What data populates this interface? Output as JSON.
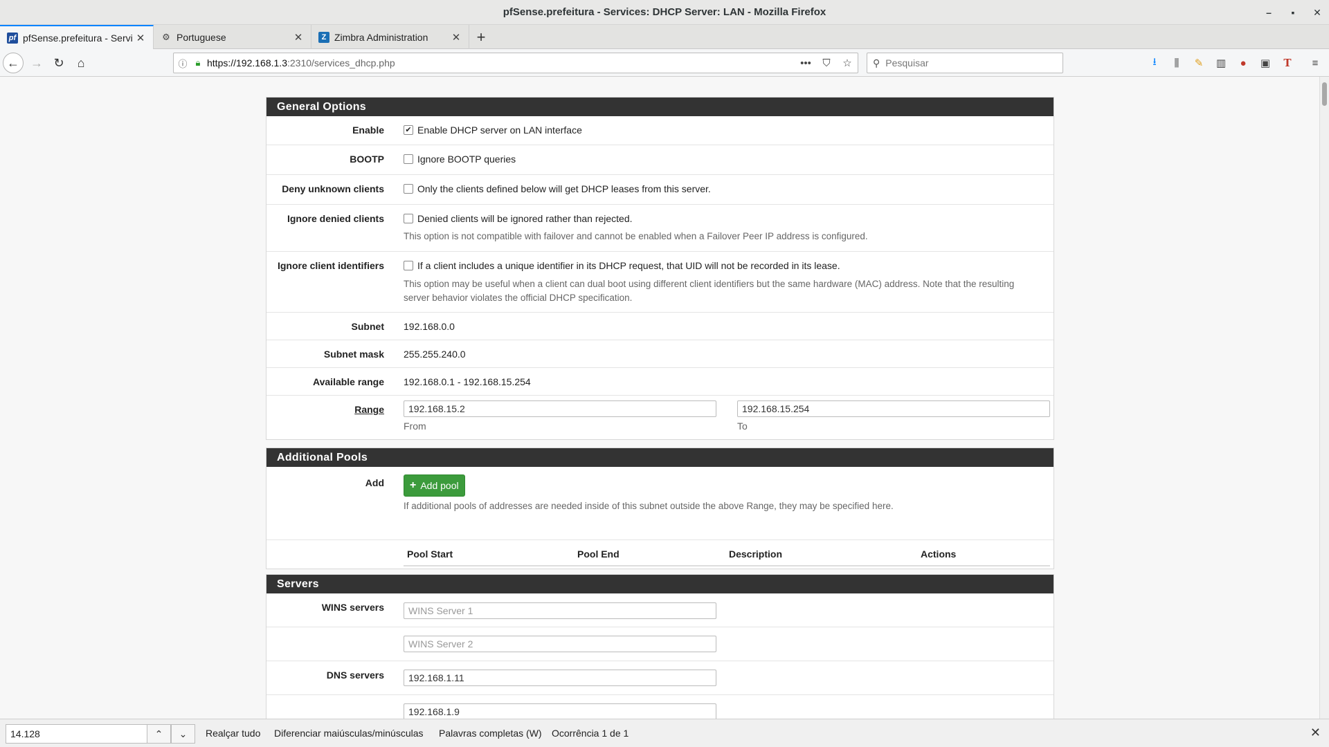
{
  "window": {
    "title": "pfSense.prefeitura - Services: DHCP Server: LAN - Mozilla Firefox",
    "min_glyph": "–",
    "max_glyph": "▪",
    "close_glyph": "✕"
  },
  "tabs": [
    {
      "label": "pfSense.prefeitura - Servi",
      "icon": "pfsense-favicon",
      "icon_text": "pf",
      "active": true
    },
    {
      "label": "Portuguese",
      "icon": "weblate-favicon",
      "icon_text": "⚙",
      "active": false
    },
    {
      "label": "Zimbra Administration",
      "icon": "zimbra-favicon",
      "icon_text": "Z",
      "active": false
    }
  ],
  "tab_close_glyph": "✕",
  "new_tab_glyph": "+",
  "nav": {
    "url_host": "https://192.168.1.3",
    "url_rest": ":2310/services_dhcp.php",
    "search_placeholder": "Pesquisar"
  },
  "general": {
    "heading": "General Options",
    "enable": {
      "label": "Enable",
      "text": "Enable DHCP server on LAN interface",
      "checked": true
    },
    "bootp": {
      "label": "BOOTP",
      "text": "Ignore BOOTP queries"
    },
    "deny": {
      "label": "Deny unknown clients",
      "text": "Only the clients defined below will get DHCP leases from this server."
    },
    "ignore_denied": {
      "label": "Ignore denied clients",
      "text": "Denied clients will be ignored rather than rejected.",
      "help": "This option is not compatible with failover and cannot be enabled when a Failover Peer IP address is configured."
    },
    "ignore_ids": {
      "label": "Ignore client identifiers",
      "text": "If a client includes a unique identifier in its DHCP request, that UID will not be recorded in its lease.",
      "help1": "This option may be useful when a client can dual boot using different client identifiers but the same hardware (MAC) address. Note that the resulting",
      "help2": "server behavior violates the official DHCP specification."
    },
    "subnet": {
      "label": "Subnet",
      "value": "192.168.0.0"
    },
    "mask": {
      "label": "Subnet mask",
      "value": "255.255.240.0"
    },
    "available": {
      "label": "Available range",
      "value": "192.168.0.1 - 192.168.15.254"
    },
    "range": {
      "label": "Range",
      "from": "192.168.15.2",
      "to": "192.168.15.254",
      "from_label": "From",
      "to_label": "To"
    }
  },
  "pools": {
    "heading": "Additional Pools",
    "add_label": "Add",
    "add_button": "Add pool",
    "help": "If additional pools of addresses are needed inside of this subnet outside the above Range, they may be specified here.",
    "columns": [
      "Pool Start",
      "Pool End",
      "Description",
      "Actions"
    ]
  },
  "servers": {
    "heading": "Servers",
    "wins_label": "WINS servers",
    "wins1_placeholder": "WINS Server 1",
    "wins2_placeholder": "WINS Server 2",
    "dns_label": "DNS servers",
    "dns1": "192.168.1.11",
    "dns2": "192.168.1.9"
  },
  "findbar": {
    "query": "14.128",
    "highlight_all": "Realçar tudo",
    "match_case": "Diferenciar maiúsculas/minúsculas",
    "whole_words": "Palavras completas (W)",
    "result": "Ocorrência 1 de 1"
  }
}
